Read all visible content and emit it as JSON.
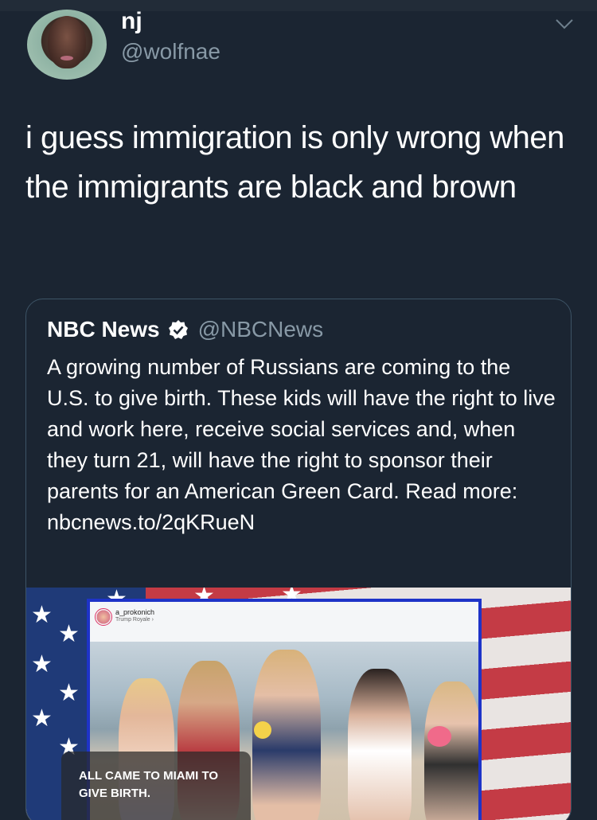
{
  "tweet": {
    "display_name": "nj",
    "handle": "@wolfnae",
    "text": "i guess immigration is only wrong when the immigrants are black and brown",
    "menu_icon": "chevron-down-icon"
  },
  "quoted_tweet": {
    "display_name": "NBC News",
    "verified_icon": "verified-badge-icon",
    "handle": "@NBCNews",
    "text": "A growing number of Russians are coming to the U.S. to give birth. These kids will have the right to live and work here, receive social services and, when they turn 21, will have the right to sponsor their parents for an American Green Card. Read more: nbcnews.to/2qKRueN",
    "media": {
      "instagram_user": "a_prokonich",
      "instagram_location": "Trump Royale ›",
      "caption": "ALL CAME TO MIAMI TO GIVE BIRTH."
    }
  },
  "colors": {
    "background": "#1b2532",
    "secondary_text": "#8899a6",
    "card_border": "#3d5466"
  }
}
